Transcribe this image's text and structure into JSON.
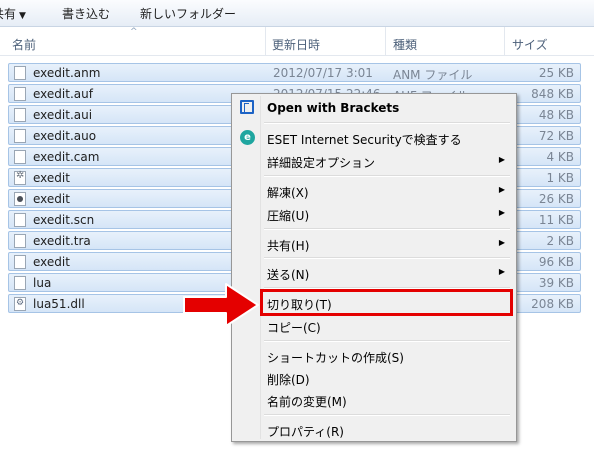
{
  "toolbar": {
    "items": [
      {
        "label": "共有"
      },
      {
        "label": "書き込む"
      },
      {
        "label": "新しいフォルダー"
      }
    ]
  },
  "columns": {
    "name": "名前",
    "date": "更新日時",
    "type": "種類",
    "size": "サイズ"
  },
  "files": [
    {
      "name": "exedit.anm",
      "date": "2012/07/17 3:01",
      "type": "ANM ファイル",
      "size": "25 KB",
      "icon": "document-icon"
    },
    {
      "name": "exedit.auf",
      "date": "2012/07/15 22:46",
      "type": "AUF ファイル",
      "size": "848 KB",
      "icon": "document-icon"
    },
    {
      "name": "exedit.aui",
      "date": "",
      "type": "",
      "size": "48 KB",
      "icon": "document-icon"
    },
    {
      "name": "exedit.auo",
      "date": "",
      "type": "",
      "size": "72 KB",
      "icon": "document-icon"
    },
    {
      "name": "exedit.cam",
      "date": "",
      "type": "",
      "size": "4 KB",
      "icon": "document-icon"
    },
    {
      "name": "exedit",
      "date": "",
      "type": "",
      "size": "1 KB",
      "icon": "settings-file-icon"
    },
    {
      "name": "exedit",
      "date": "",
      "type": "",
      "size": "26 KB",
      "icon": "application-icon"
    },
    {
      "name": "exedit.scn",
      "date": "",
      "type": "",
      "size": "11 KB",
      "icon": "document-icon"
    },
    {
      "name": "exedit.tra",
      "date": "",
      "type": "",
      "size": "2 KB",
      "icon": "document-icon"
    },
    {
      "name": "exedit",
      "date": "",
      "type": "",
      "size": "96 KB",
      "icon": "document-icon"
    },
    {
      "name": "lua",
      "date": "",
      "type": "",
      "size": "39 KB",
      "icon": "document-icon"
    },
    {
      "name": "lua51.dll",
      "date": "",
      "type": "",
      "size": "208 KB",
      "icon": "dll-icon"
    }
  ],
  "context_menu": {
    "items": [
      {
        "label": "Open with Brackets",
        "bold": true,
        "icon": "brackets-icon"
      },
      {
        "label": "ESET Internet Securityで検査する",
        "icon": "eset-icon"
      },
      {
        "label": "詳細設定オプション",
        "submenu": true
      },
      {
        "label": "解凍(X)",
        "submenu": true
      },
      {
        "label": "圧縮(U)",
        "submenu": true
      },
      {
        "label": "共有(H)",
        "submenu": true
      },
      {
        "label": "送る(N)",
        "submenu": true
      },
      {
        "label": "切り取り(T)",
        "highlighted": true
      },
      {
        "label": "コピー(C)"
      },
      {
        "label": "ショートカットの作成(S)"
      },
      {
        "label": "削除(D)"
      },
      {
        "label": "名前の変更(M)"
      },
      {
        "label": "プロパティ(R)"
      }
    ]
  },
  "colors": {
    "selection_fill": "#d9e7f8",
    "selection_border": "#a6c4e6",
    "highlight": "#e40000",
    "menu_bg": "#f0f0f0"
  }
}
